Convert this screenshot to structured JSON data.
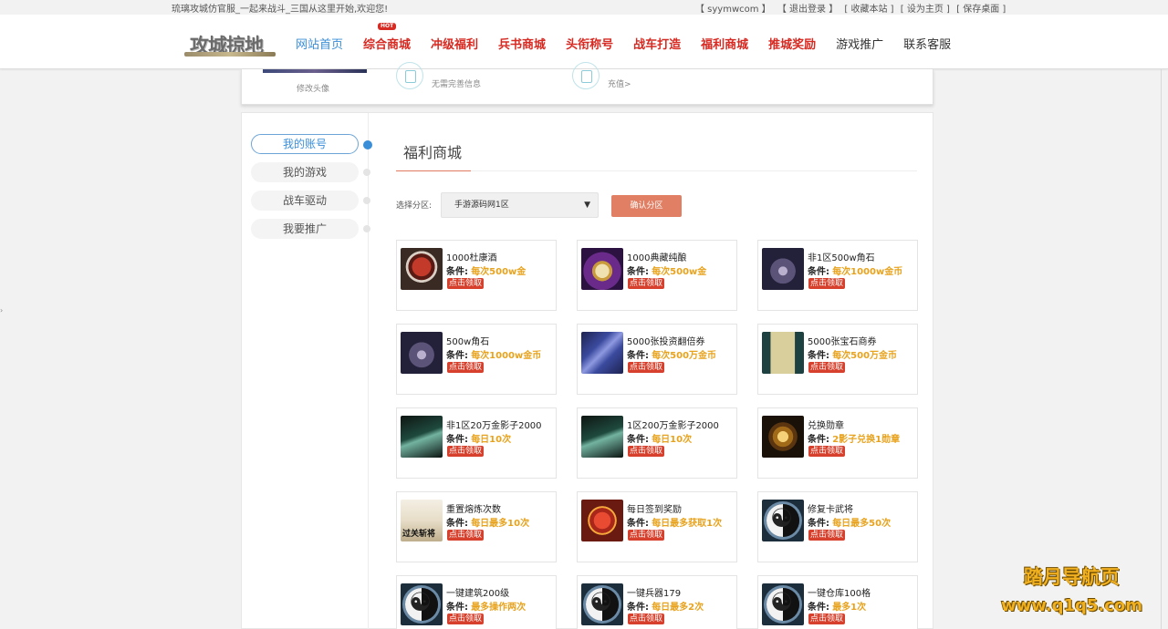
{
  "topbar": {
    "welcome": "琉璃攻城仿官服_一起来战斗_三国从这里开始,欢迎您!",
    "links": [
      "【 syymwcom 】",
      "【 退出登录 】",
      "[ 收藏本站 ]",
      "[ 设为主页 ]",
      "[ 保存桌面 ]"
    ]
  },
  "header": {
    "logo_text": "攻城掠地",
    "nav": [
      {
        "label": "网站首页",
        "style": "active"
      },
      {
        "label": "综合商城",
        "style": "red",
        "badge": "HOT"
      },
      {
        "label": "冲级福利",
        "style": "red"
      },
      {
        "label": "兵书商城",
        "style": "red"
      },
      {
        "label": "头衔称号",
        "style": "red"
      },
      {
        "label": "战车打造",
        "style": "red"
      },
      {
        "label": "福利商城",
        "style": "red"
      },
      {
        "label": "推城奖励",
        "style": "red"
      },
      {
        "label": "游戏推广",
        "style": "plain"
      },
      {
        "label": "联系客服",
        "style": "plain"
      }
    ]
  },
  "profile": {
    "change_avatar": "修改头像",
    "info_1": "无需完善信息",
    "info_2": "充值>"
  },
  "sidebar": {
    "items": [
      {
        "label": "我的账号",
        "active": true
      },
      {
        "label": "我的游戏",
        "active": false
      },
      {
        "label": "战车驱动",
        "active": false
      },
      {
        "label": "我要推广",
        "active": false
      }
    ]
  },
  "content": {
    "title": "福利商城",
    "zone_label": "选择分区:",
    "zone_selected": "手游源码网1区",
    "zone_button": "确认分区",
    "condition_label": "条件:",
    "claim_label": "点击领取"
  },
  "items": [
    {
      "name": "1000杜康酒",
      "condition": "每次500w金",
      "icon": "wine-icon"
    },
    {
      "name": "1000典藏纯酿",
      "condition": "每次500w金",
      "icon": "jug-icon"
    },
    {
      "name": "非1区500w角石",
      "condition": "每次1000w金币",
      "icon": "stone-icon"
    },
    {
      "name": "500w角石",
      "condition": "每次1000w金币",
      "icon": "stone-icon"
    },
    {
      "name": "5000张投资翻倍券",
      "condition": "每次500万金币",
      "icon": "scroll-icon"
    },
    {
      "name": "5000张宝石商券",
      "condition": "每次500万金币",
      "icon": "jewel-scroll-icon"
    },
    {
      "name": "非1区20万金影子2000",
      "condition": "每日10次",
      "icon": "shadow-icon"
    },
    {
      "name": "1区200万金影子2000",
      "condition": "每日10次",
      "icon": "shadow-icon"
    },
    {
      "name": "兑换勋章",
      "condition": "2影子兑换1勋章",
      "icon": "medal-icon"
    },
    {
      "name": "重置熔炼次数",
      "condition": "每日最多10次",
      "icon": "hero-icon"
    },
    {
      "name": "每日签到奖励",
      "condition": "每日最多获取1次",
      "icon": "gift-icon"
    },
    {
      "name": "修复卡武将",
      "condition": "每日最多50次",
      "icon": "taiji-icon"
    },
    {
      "name": "一键建筑200级",
      "condition": "最多操作两次",
      "icon": "taiji-icon"
    },
    {
      "name": "一键兵器179",
      "condition": "每日最多2次",
      "icon": "taiji-icon"
    },
    {
      "name": "一键仓库100格",
      "condition": "最多1次",
      "icon": "taiji-icon"
    }
  ],
  "watermark": {
    "title": "踏月导航页",
    "url": "www.q1q5.com"
  },
  "colors": {
    "accent_blue": "#3a8ed8",
    "nav_red": "#d62a22",
    "condition_gold": "#e8a31e",
    "claim_red": "#d6402c",
    "button_salmon": "#e07f63"
  }
}
